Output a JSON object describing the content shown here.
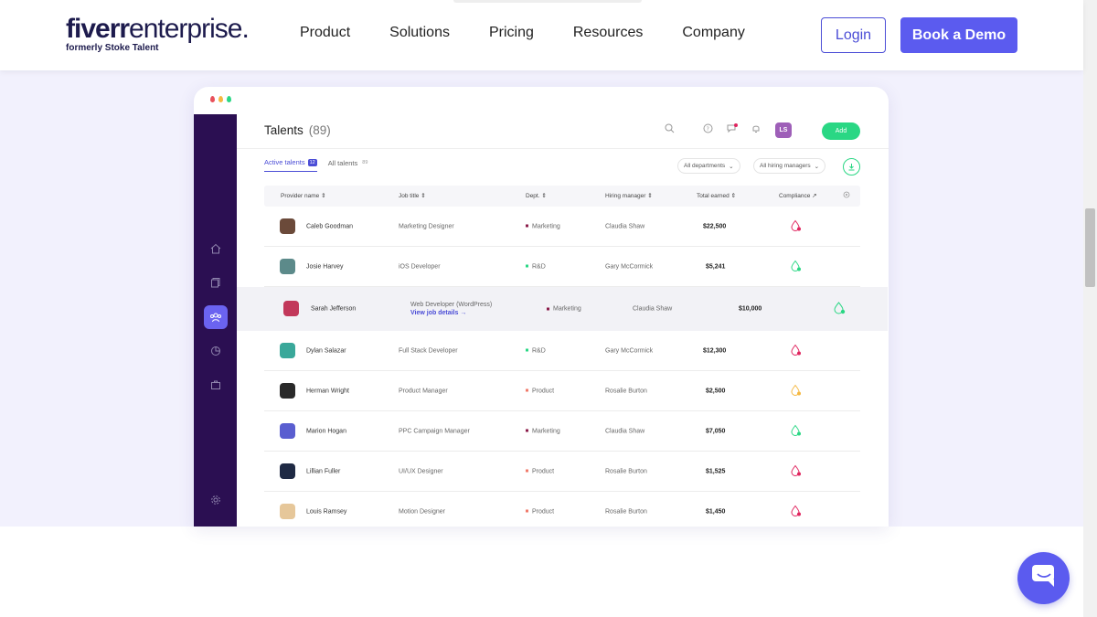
{
  "nav": {
    "logo_brand": "fiverr",
    "logo_suffix": "enterprise.",
    "logo_sub": "formerly Stoke Talent",
    "links": [
      "Product",
      "Solutions",
      "Pricing",
      "Resources",
      "Company"
    ],
    "login": "Login",
    "demo": "Book a Demo"
  },
  "app": {
    "title": "Talents",
    "count": "(89)",
    "avatar_initials": "LS",
    "add_label": "Add",
    "tabs": [
      {
        "label": "Active talents",
        "badge": "12"
      },
      {
        "label": "All talents",
        "badge": "89"
      }
    ],
    "filters": [
      "All departments",
      "All hiring managers"
    ],
    "columns": [
      "Provider name",
      "Job title",
      "Dept.",
      "Hiring manager",
      "Total earned",
      "Compliance"
    ],
    "view_details": "View job details →",
    "rows": [
      {
        "name": "Caleb Goodman",
        "job": "Marketing Designer",
        "dept": "Marketing",
        "manager": "Claudia Shaw",
        "earned": "$22,500",
        "compliance": "red"
      },
      {
        "name": "Josie Harvey",
        "job": "iOS Developer",
        "dept": "R&D",
        "manager": "Gary McCormick",
        "earned": "$5,241",
        "compliance": "green"
      },
      {
        "name": "Sarah Jefferson",
        "job": "Web Developer (WordPress)",
        "dept": "Marketing",
        "manager": "Claudia Shaw",
        "earned": "$10,000",
        "compliance": "green"
      },
      {
        "name": "Dylan Salazar",
        "job": "Full Stack Developer",
        "dept": "R&D",
        "manager": "Gary McCormick",
        "earned": "$12,300",
        "compliance": "red"
      },
      {
        "name": "Herman Wright",
        "job": "Product Manager",
        "dept": "Product",
        "manager": "Rosalie Burton",
        "earned": "$2,500",
        "compliance": "yellow"
      },
      {
        "name": "Marion Hogan",
        "job": "PPC Campaign Manager",
        "dept": "Marketing",
        "manager": "Claudia Shaw",
        "earned": "$7,050",
        "compliance": "green"
      },
      {
        "name": "Lillian Fuller",
        "job": "UI/UX Designer",
        "dept": "Product",
        "manager": "Rosalie Burton",
        "earned": "$1,525",
        "compliance": "red"
      },
      {
        "name": "Louis Ramsey",
        "job": "Motion Designer",
        "dept": "Product",
        "manager": "Rosalie Burton",
        "earned": "$1,450",
        "compliance": "red"
      }
    ]
  },
  "colors": {
    "brand": "#5b5bef",
    "sidebar": "#2b0f52",
    "hero_bg": "#f2f1fd",
    "marketing": "#8b1c4a",
    "rnd": "#2ad784",
    "product": "#f07a6a",
    "compliance_red": "#e0245e",
    "compliance_green": "#2ad784",
    "compliance_yellow": "#f5b842"
  }
}
